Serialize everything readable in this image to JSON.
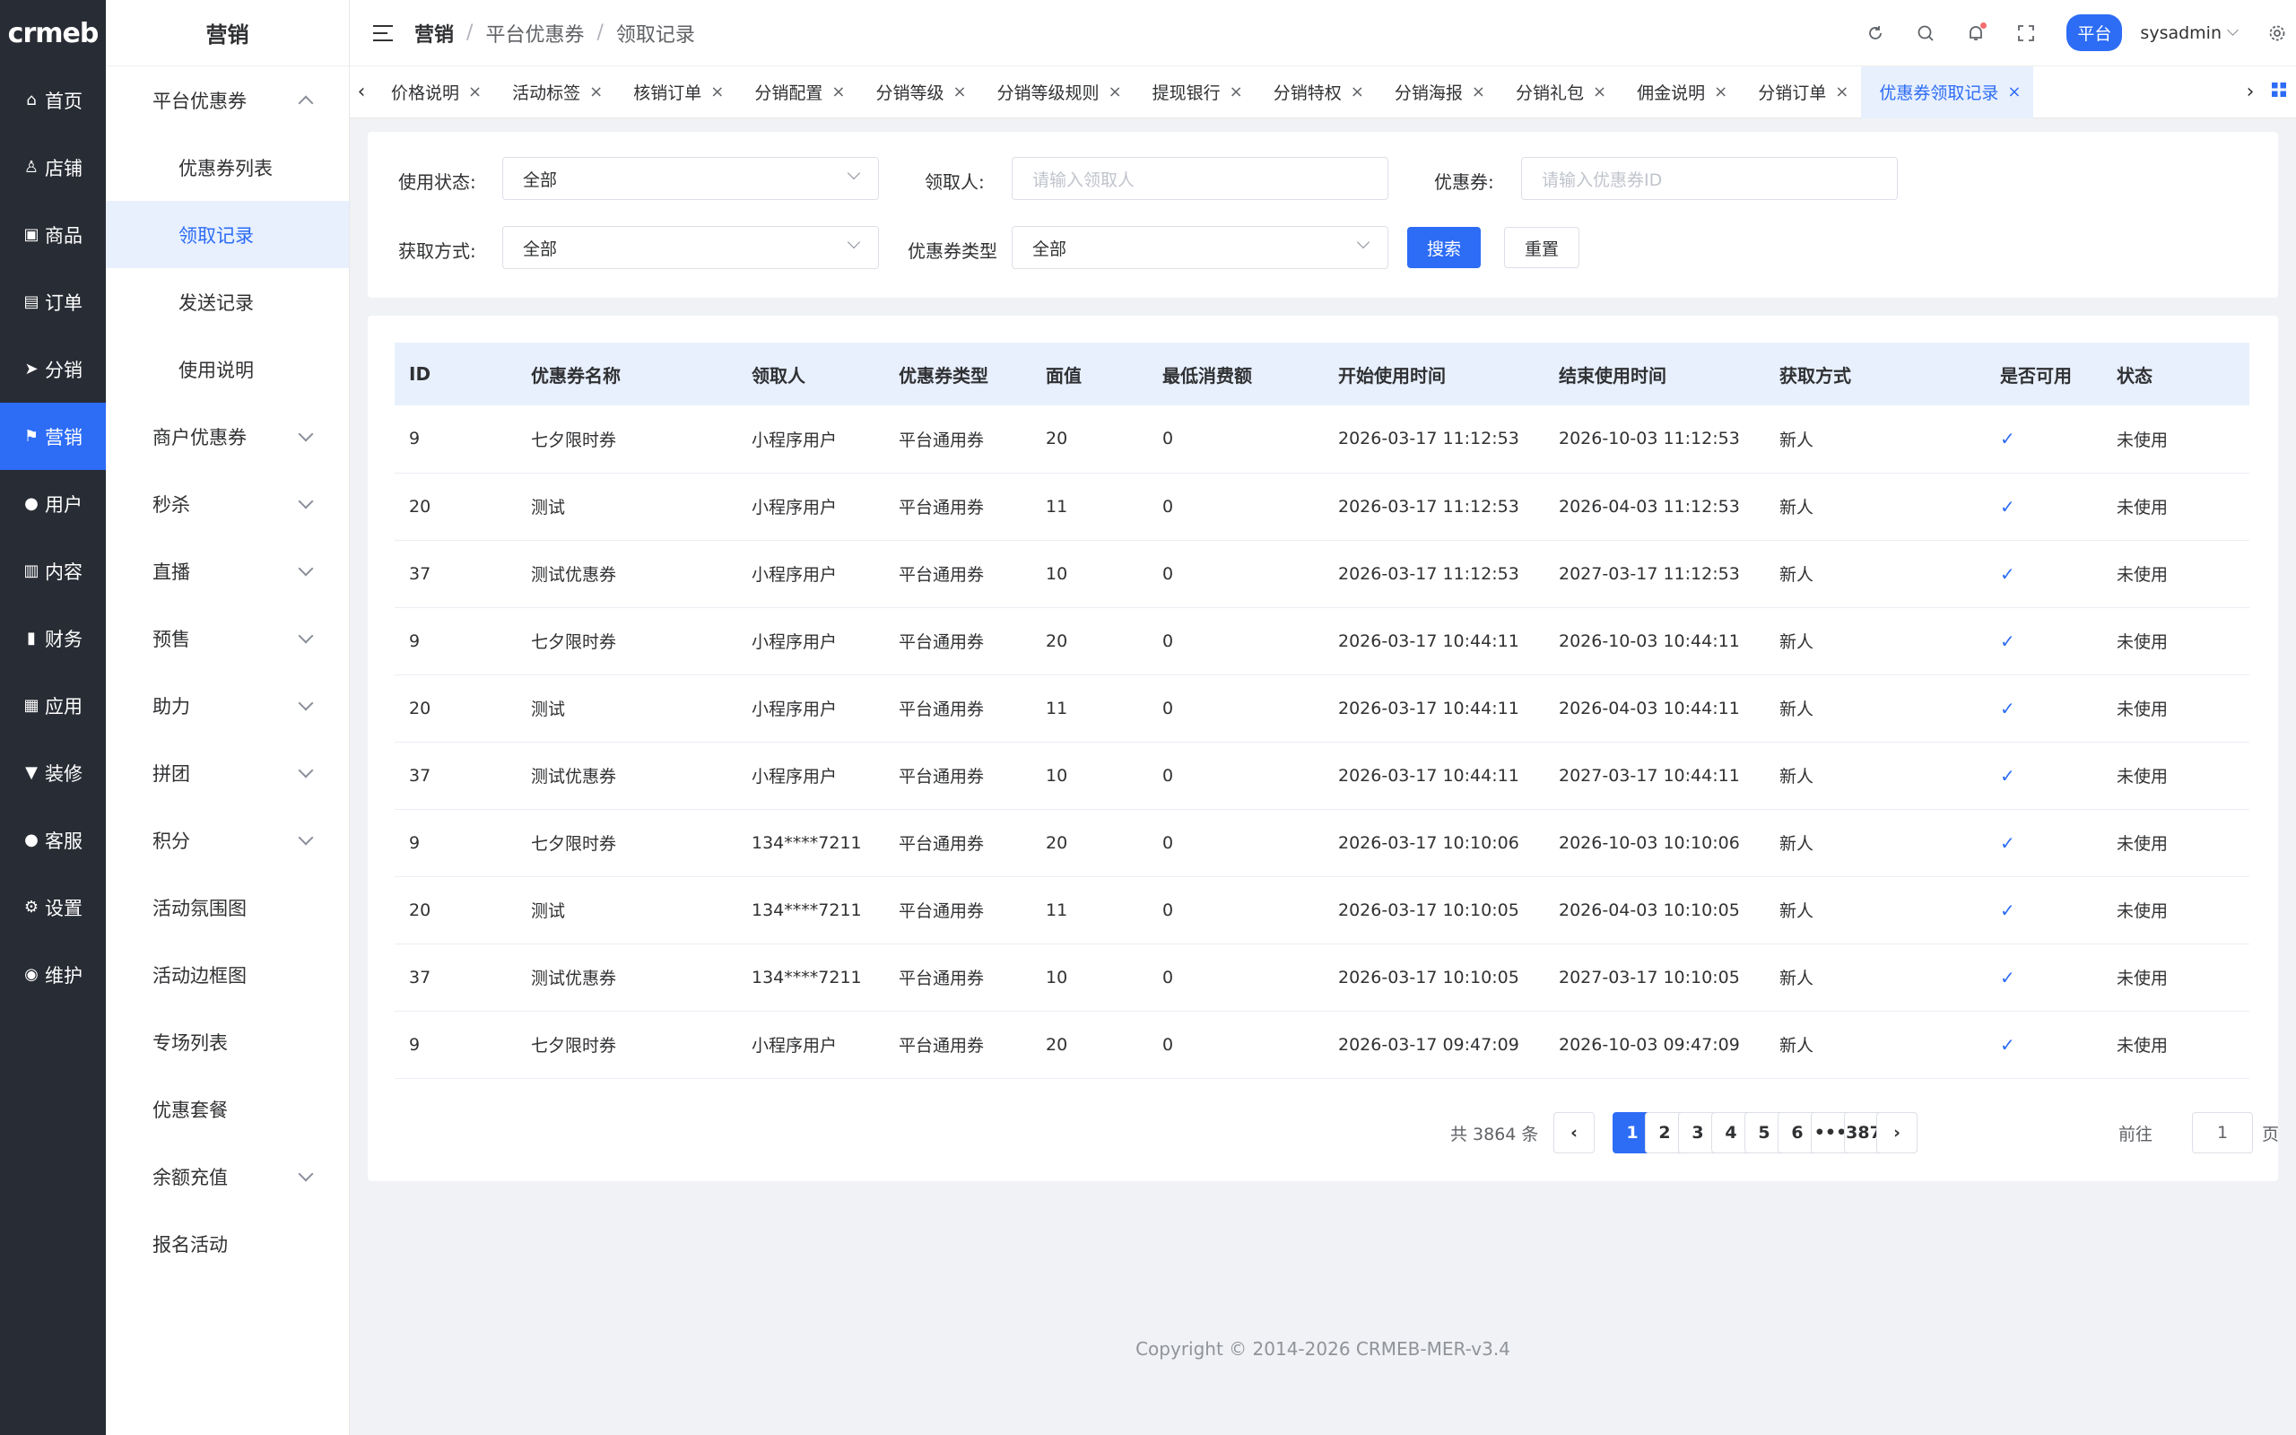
{
  "logo": "crmeb",
  "rail": [
    {
      "icon": "home-icon",
      "glyph": "⌂",
      "label": "首页"
    },
    {
      "icon": "store-icon",
      "glyph": "♙",
      "label": "店铺"
    },
    {
      "icon": "bag-icon",
      "glyph": "▣",
      "label": "商品"
    },
    {
      "icon": "order-icon",
      "glyph": "▤",
      "label": "订单"
    },
    {
      "icon": "send-icon",
      "glyph": "➤",
      "label": "分销"
    },
    {
      "icon": "flag-icon",
      "glyph": "⚑",
      "label": "营销",
      "active": true
    },
    {
      "icon": "user-icon",
      "glyph": "●",
      "label": "用户"
    },
    {
      "icon": "content-icon",
      "glyph": "▥",
      "label": "内容"
    },
    {
      "icon": "chart-icon",
      "glyph": "▮",
      "label": "财务"
    },
    {
      "icon": "apps-icon",
      "glyph": "▦",
      "label": "应用"
    },
    {
      "icon": "decorate-icon",
      "glyph": "▼",
      "label": "装修"
    },
    {
      "icon": "service-icon",
      "glyph": "●",
      "label": "客服"
    },
    {
      "icon": "gear-icon",
      "glyph": "⚙",
      "label": "设置"
    },
    {
      "icon": "maintain-icon",
      "glyph": "◉",
      "label": "维护"
    }
  ],
  "submenu": {
    "title": "营销",
    "items": [
      {
        "label": "平台优惠券",
        "chevron": "up"
      },
      {
        "label": "优惠券列表",
        "child": true
      },
      {
        "label": "领取记录",
        "child": true,
        "active": true
      },
      {
        "label": "发送记录",
        "child": true
      },
      {
        "label": "使用说明",
        "child": true
      },
      {
        "label": "商户优惠券",
        "chevron": "down"
      },
      {
        "label": "秒杀",
        "chevron": "down"
      },
      {
        "label": "直播",
        "chevron": "down"
      },
      {
        "label": "预售",
        "chevron": "down"
      },
      {
        "label": "助力",
        "chevron": "down"
      },
      {
        "label": "拼团",
        "chevron": "down"
      },
      {
        "label": "积分",
        "chevron": "down"
      },
      {
        "label": "活动氛围图"
      },
      {
        "label": "活动边框图"
      },
      {
        "label": "专场列表"
      },
      {
        "label": "优惠套餐"
      },
      {
        "label": "余额充值",
        "chevron": "down"
      },
      {
        "label": "报名活动"
      }
    ]
  },
  "header": {
    "breadcrumb": [
      "营销",
      "平台优惠券",
      "领取记录"
    ],
    "breadcrumb_sep": "/",
    "role": "平台",
    "username": "sysadmin"
  },
  "tabs": [
    {
      "label": "价格说明"
    },
    {
      "label": "活动标签"
    },
    {
      "label": "核销订单"
    },
    {
      "label": "分销配置"
    },
    {
      "label": "分销等级"
    },
    {
      "label": "分销等级规则"
    },
    {
      "label": "提现银行"
    },
    {
      "label": "分销特权"
    },
    {
      "label": "分销海报"
    },
    {
      "label": "分销礼包"
    },
    {
      "label": "佣金说明"
    },
    {
      "label": "分销订单"
    },
    {
      "label": "优惠券领取记录",
      "active": true
    }
  ],
  "filters": {
    "status_label": "使用状态:",
    "status_value": "全部",
    "receiver_label": "领取人:",
    "receiver_placeholder": "请输入领取人",
    "coupon_label": "优惠券:",
    "coupon_placeholder": "请输入优惠券ID",
    "method_label": "获取方式:",
    "method_value": "全部",
    "type_label": "优惠券类型",
    "type_value": "全部",
    "search_label": "搜索",
    "reset_label": "重置"
  },
  "table": {
    "columns": [
      "ID",
      "优惠券名称",
      "领取人",
      "优惠券类型",
      "面值",
      "最低消费额",
      "开始使用时间",
      "结束使用时间",
      "获取方式",
      "是否可用",
      "状态"
    ],
    "rows": [
      [
        "9",
        "七夕限时券",
        "小程序用户",
        "平台通用券",
        "20",
        "0",
        "2026-03-17 11:12:53",
        "2026-10-03 11:12:53",
        "新人",
        "✓",
        "未使用"
      ],
      [
        "20",
        "测试",
        "小程序用户",
        "平台通用券",
        "11",
        "0",
        "2026-03-17 11:12:53",
        "2026-04-03 11:12:53",
        "新人",
        "✓",
        "未使用"
      ],
      [
        "37",
        "测试优惠券",
        "小程序用户",
        "平台通用券",
        "10",
        "0",
        "2026-03-17 11:12:53",
        "2027-03-17 11:12:53",
        "新人",
        "✓",
        "未使用"
      ],
      [
        "9",
        "七夕限时券",
        "小程序用户",
        "平台通用券",
        "20",
        "0",
        "2026-03-17 10:44:11",
        "2026-10-03 10:44:11",
        "新人",
        "✓",
        "未使用"
      ],
      [
        "20",
        "测试",
        "小程序用户",
        "平台通用券",
        "11",
        "0",
        "2026-03-17 10:44:11",
        "2026-04-03 10:44:11",
        "新人",
        "✓",
        "未使用"
      ],
      [
        "37",
        "测试优惠券",
        "小程序用户",
        "平台通用券",
        "10",
        "0",
        "2026-03-17 10:44:11",
        "2027-03-17 10:44:11",
        "新人",
        "✓",
        "未使用"
      ],
      [
        "9",
        "七夕限时券",
        "134****7211",
        "平台通用券",
        "20",
        "0",
        "2026-03-17 10:10:06",
        "2026-10-03 10:10:06",
        "新人",
        "✓",
        "未使用"
      ],
      [
        "20",
        "测试",
        "134****7211",
        "平台通用券",
        "11",
        "0",
        "2026-03-17 10:10:05",
        "2026-04-03 10:10:05",
        "新人",
        "✓",
        "未使用"
      ],
      [
        "37",
        "测试优惠券",
        "134****7211",
        "平台通用券",
        "10",
        "0",
        "2026-03-17 10:10:05",
        "2027-03-17 10:10:05",
        "新人",
        "✓",
        "未使用"
      ],
      [
        "9",
        "七夕限时券",
        "小程序用户",
        "平台通用券",
        "20",
        "0",
        "2026-03-17 09:47:09",
        "2026-10-03 09:47:09",
        "新人",
        "✓",
        "未使用"
      ]
    ]
  },
  "pagination": {
    "total_text": "共 3864 条",
    "pages": [
      "1",
      "2",
      "3",
      "4",
      "5",
      "6",
      "•••",
      "387"
    ],
    "current": "1",
    "goto_label": "前往",
    "goto_value": "1",
    "goto_unit": "页"
  },
  "footer": {
    "copyright": "Copyright © 2014-2026 CRMEB-MER-v3.4"
  },
  "colors": {
    "primary": "#2d6cf5",
    "rail_bg": "#282c34",
    "header_row_bg": "#e8f0fe"
  }
}
